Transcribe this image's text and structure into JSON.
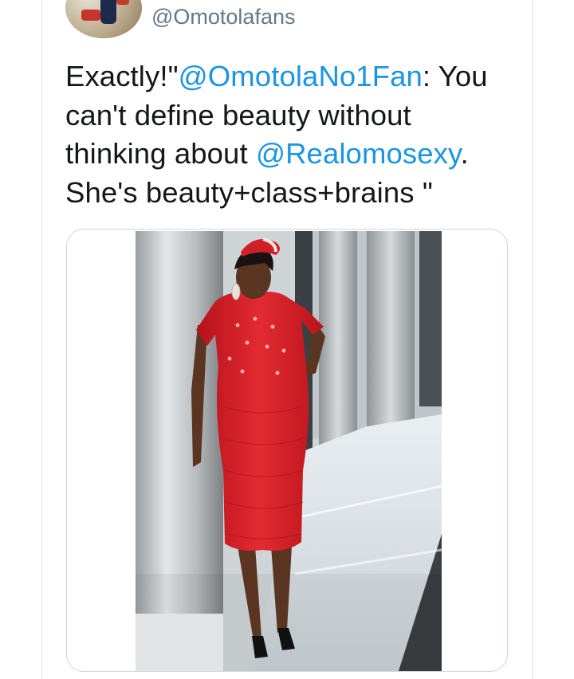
{
  "tweet": {
    "handle": "@Omotolafans",
    "text_line1_a": "Exactly!\"",
    "mention1": "@OmotolaNo1Fan",
    "text_line1_b": ": You",
    "text_line2": "can't define beauty without",
    "text_line3_a": "thinking about ",
    "mention2": "@Realomosexy",
    "text_line3_b": ".",
    "text_line4": "She's beauty+class+brains \""
  },
  "colors": {
    "mention": "#1b95e0",
    "handle": "#657786",
    "text": "#14171a",
    "dress": "#d9232b"
  },
  "icons": {
    "avatar": "profile-avatar"
  }
}
